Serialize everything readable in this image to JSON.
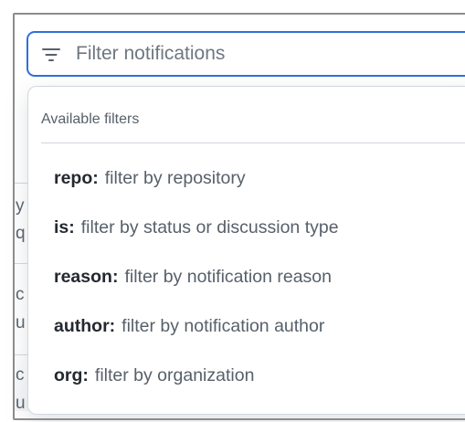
{
  "search": {
    "placeholder": "Filter notifications",
    "icon": "filter-lines-icon"
  },
  "dropdown": {
    "header": "Available filters",
    "filters": [
      {
        "key": "repo:",
        "description": "filter by repository"
      },
      {
        "key": "is:",
        "description": "filter by status or discussion type"
      },
      {
        "key": "reason:",
        "description": "filter by notification reason"
      },
      {
        "key": "author:",
        "description": "filter by notification author"
      },
      {
        "key": "org:",
        "description": "filter by organization"
      }
    ]
  },
  "background_fragments": [
    "y",
    "q",
    "c",
    "u",
    "c",
    "u"
  ],
  "colors": {
    "accent": "#2f6fdc",
    "text_primary": "#24292f",
    "text_muted": "#57606a",
    "border": "#d0d7de"
  }
}
